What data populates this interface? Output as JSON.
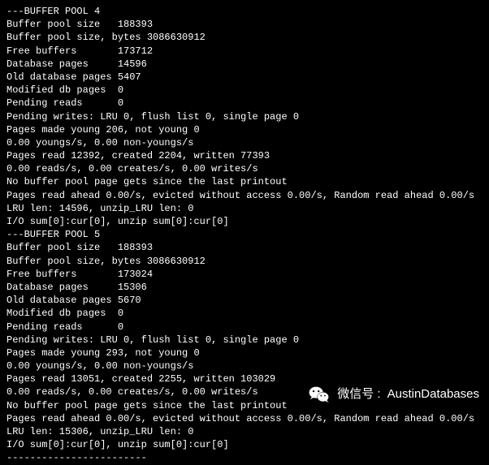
{
  "terminal": {
    "lines": [
      "---BUFFER POOL 4",
      "Buffer pool size   188393",
      "Buffer pool size, bytes 3086630912",
      "Free buffers       173712",
      "Database pages     14596",
      "Old database pages 5407",
      "Modified db pages  0",
      "Pending reads      0",
      "Pending writes: LRU 0, flush list 0, single page 0",
      "Pages made young 206, not young 0",
      "0.00 youngs/s, 0.00 non-youngs/s",
      "Pages read 12392, created 2204, written 77393",
      "0.00 reads/s, 0.00 creates/s, 0.00 writes/s",
      "No buffer pool page gets since the last printout",
      "Pages read ahead 0.00/s, evicted without access 0.00/s, Random read ahead 0.00/s",
      "LRU len: 14596, unzip_LRU len: 0",
      "I/O sum[0]:cur[0], unzip sum[0]:cur[0]",
      "---BUFFER POOL 5",
      "Buffer pool size   188393",
      "Buffer pool size, bytes 3086630912",
      "Free buffers       173024",
      "Database pages     15306",
      "Old database pages 5670",
      "Modified db pages  0",
      "Pending reads      0",
      "Pending writes: LRU 0, flush list 0, single page 0",
      "Pages made young 293, not young 0",
      "0.00 youngs/s, 0.00 non-youngs/s",
      "Pages read 13051, created 2255, written 103029",
      "0.00 reads/s, 0.00 creates/s, 0.00 writes/s",
      "No buffer pool page gets since the last printout",
      "Pages read ahead 0.00/s, evicted without access 0.00/s, Random read ahead 0.00/s",
      "LRU len: 15306, unzip_LRU len: 0",
      "I/O sum[0]:cur[0], unzip sum[0]:cur[0]",
      "------------------------"
    ]
  },
  "watermark": {
    "label": "微信号 :",
    "value": "AustinDatabases",
    "icon": "wechat-icon"
  }
}
